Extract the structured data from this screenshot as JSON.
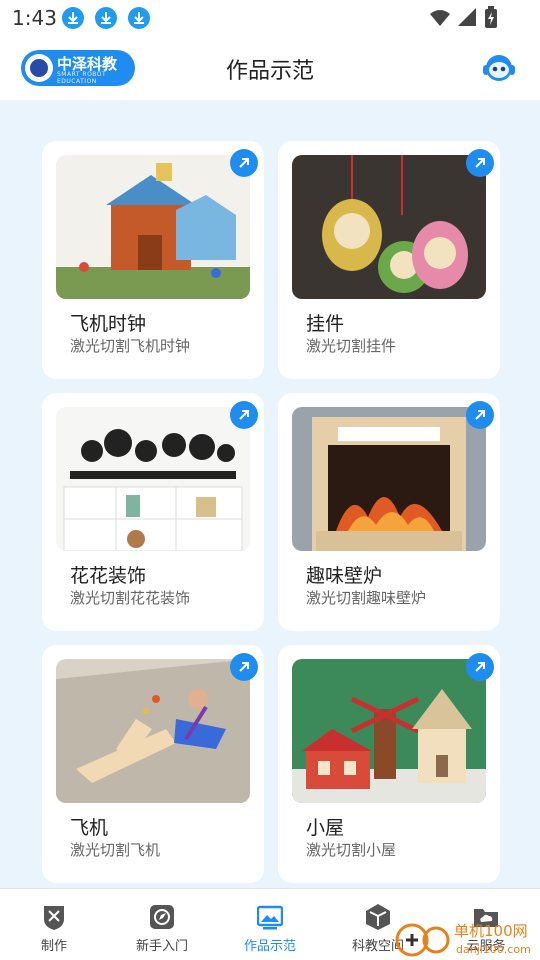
{
  "status": {
    "time": "1:43"
  },
  "header": {
    "brand_name": "中泽科教",
    "brand_sub": "SMART ROBOT EDUCATION",
    "title": "作品示范"
  },
  "cards": [
    {
      "title": "飞机时钟",
      "desc": "激光切割飞机时钟"
    },
    {
      "title": "挂件",
      "desc": "激光切割挂件"
    },
    {
      "title": "花花装饰",
      "desc": "激光切割花花装饰"
    },
    {
      "title": "趣味壁炉",
      "desc": "激光切割趣味壁炉"
    },
    {
      "title": "飞机",
      "desc": "激光切割飞机"
    },
    {
      "title": "小屋",
      "desc": "激光切割小屋"
    }
  ],
  "tabs": [
    {
      "label": "制作"
    },
    {
      "label": "新手入门"
    },
    {
      "label": "作品示范"
    },
    {
      "label": "科教空间"
    },
    {
      "label": "云服务"
    }
  ],
  "colors": {
    "accent": "#1f8df0",
    "background": "#e9f4fd"
  },
  "watermark": {
    "brand": "单机100网",
    "url": "danji100.com"
  }
}
